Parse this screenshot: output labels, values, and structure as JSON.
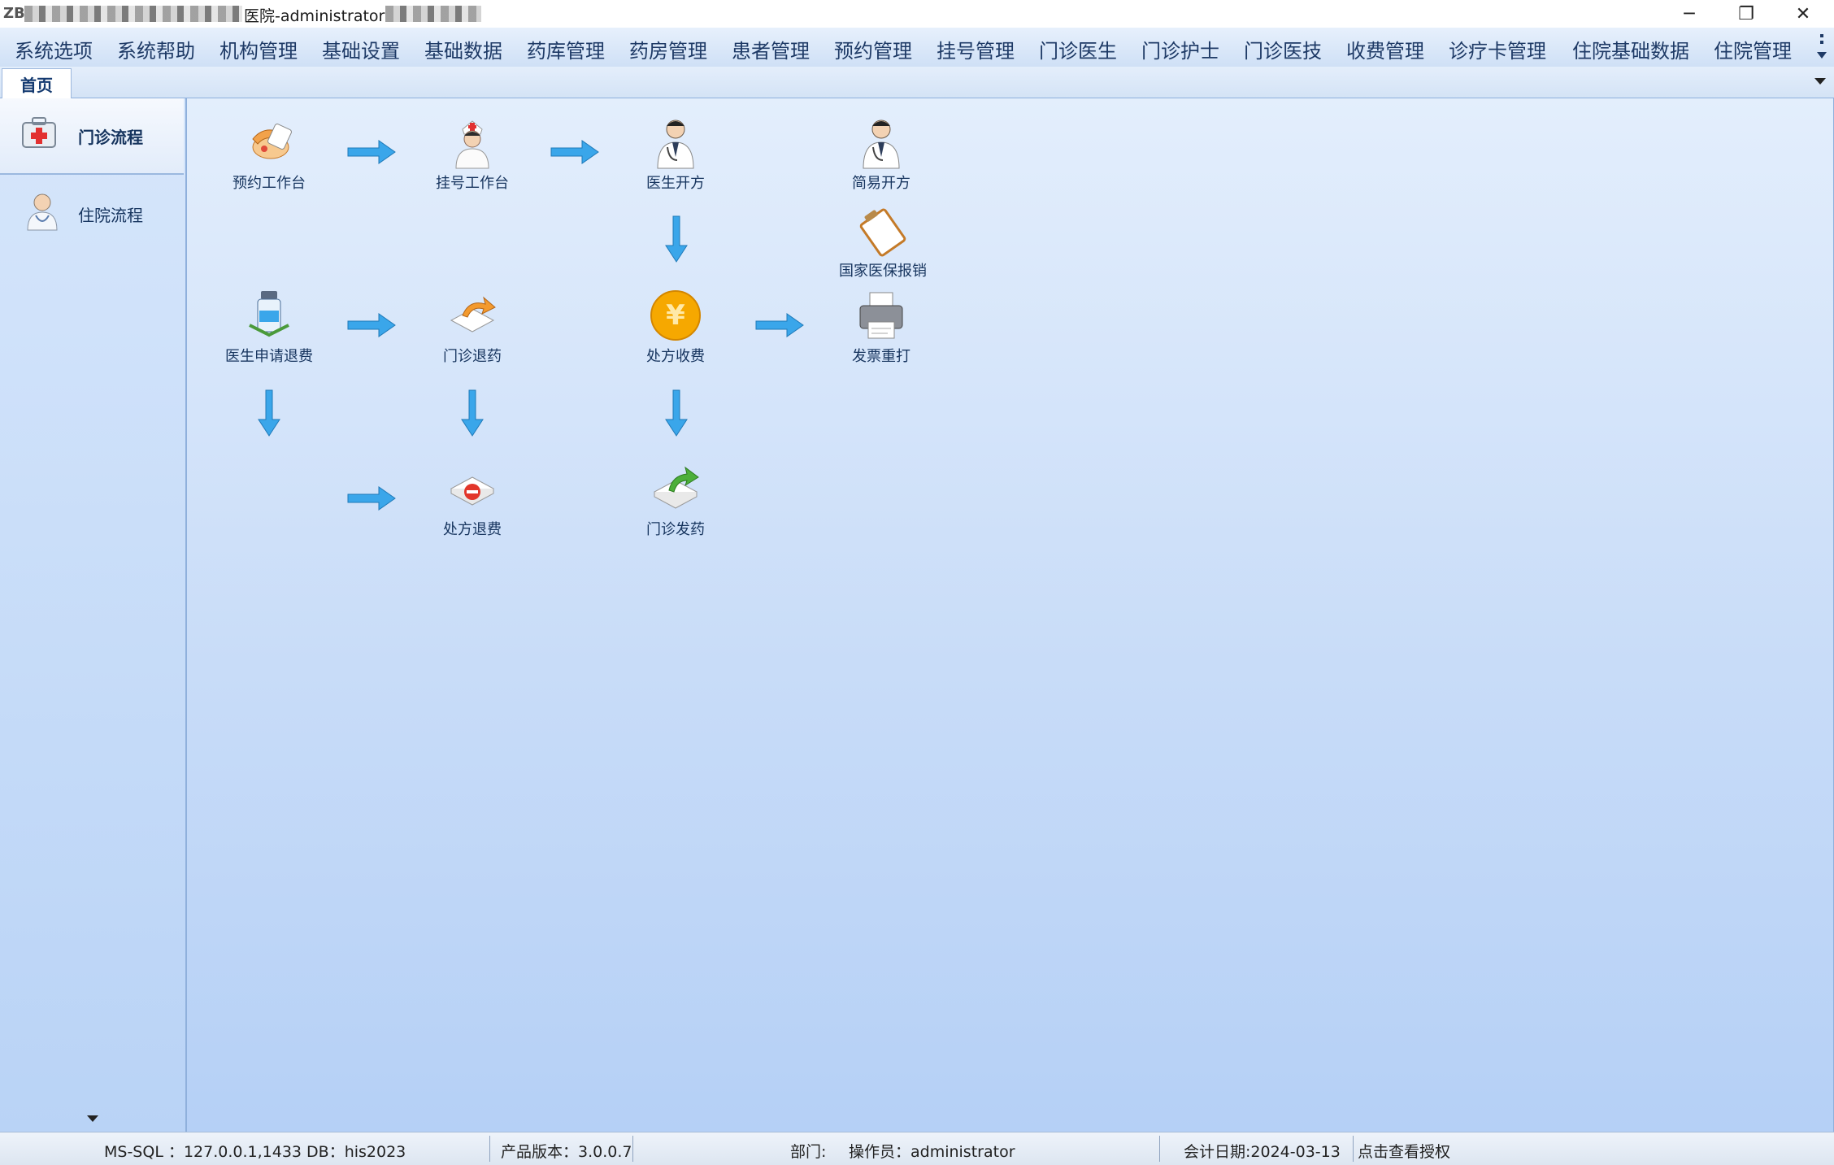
{
  "window": {
    "logo": "ZB",
    "title": "医院-administrator",
    "minimize_glyph": "─",
    "maximize_glyph": "❐",
    "close_glyph": "✕"
  },
  "menu": {
    "items": [
      "系统选项",
      "系统帮助",
      "机构管理",
      "基础设置",
      "基础数据",
      "药库管理",
      "药房管理",
      "患者管理",
      "预约管理",
      "挂号管理",
      "门诊医生",
      "门诊护士",
      "门诊医技",
      "收费管理",
      "诊疗卡管理",
      "住院基础数据",
      "住院管理"
    ]
  },
  "tabs": {
    "home": "首页"
  },
  "leftnav": {
    "items": [
      {
        "label": "门诊流程",
        "icon": "medical-kit-icon"
      },
      {
        "label": "住院流程",
        "icon": "doctor-icon"
      }
    ]
  },
  "flow": {
    "nodes": {
      "appointment": "预约工作台",
      "registration": "挂号工作台",
      "prescribe": "医生开方",
      "simple_prescribe": "简易开方",
      "insurance": "国家医保报销",
      "refund_request": "医生申请退费",
      "drug_return": "门诊退药",
      "charge": "处方收费",
      "invoice_reprint": "发票重打",
      "prescription_refund": "处方退费",
      "dispense": "门诊发药"
    }
  },
  "status": {
    "db": "MS-SQL  ：127.0.0.1,1433 DB：his2023",
    "version": "产品版本：3.0.0.7",
    "dept": "部门:",
    "operator": "操作员：administrator",
    "account_date": "会计日期:2024-03-13",
    "license": "点击查看授权"
  },
  "colors": {
    "accent": "#1e3a66",
    "arrow": "#3aa6ea",
    "canvas_top": "#e3eefc",
    "canvas_bottom": "#b5d0f6"
  }
}
